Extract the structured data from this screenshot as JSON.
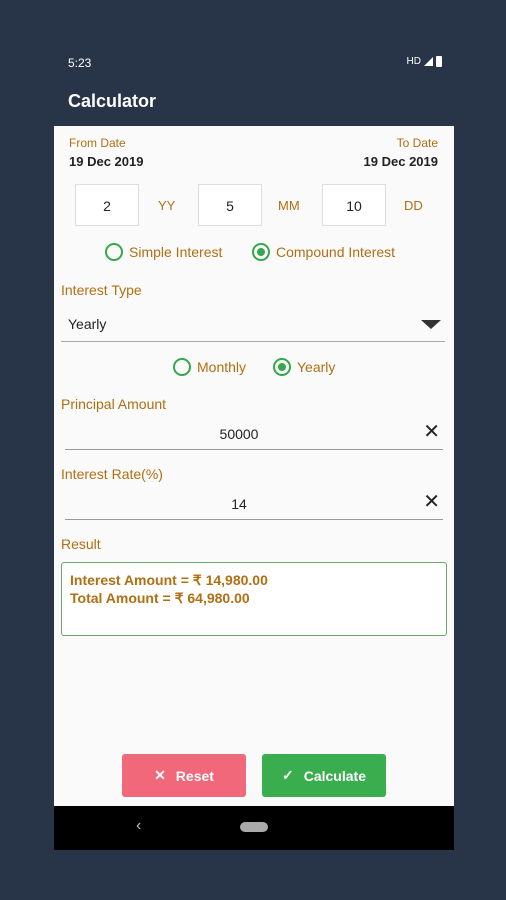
{
  "status": {
    "time": "5:23",
    "hd": "HD"
  },
  "app": {
    "title": "Calculator"
  },
  "dates": {
    "from_label": "From Date",
    "from_value": "19 Dec 2019",
    "to_label": "To Date",
    "to_value": "19 Dec 2019"
  },
  "duration": {
    "years": "2",
    "years_label": "YY",
    "months": "5",
    "months_label": "MM",
    "days": "10",
    "days_label": "DD"
  },
  "interest_mode": {
    "simple": "Simple Interest",
    "compound": "Compound Interest",
    "selected": "compound"
  },
  "interest_type": {
    "label": "Interest Type",
    "value": "Yearly"
  },
  "frequency": {
    "monthly": "Monthly",
    "yearly": "Yearly",
    "selected": "yearly"
  },
  "principal": {
    "label": "Principal Amount",
    "value": "50000"
  },
  "rate": {
    "label": "Interest Rate(%)",
    "value": "14"
  },
  "result": {
    "label": "Result",
    "interest_line": "Interest Amount = ₹ 14,980.00",
    "total_line": "Total Amount = ₹ 64,980.00"
  },
  "buttons": {
    "reset": "Reset",
    "calculate": "Calculate"
  },
  "colors": {
    "background": "#283549",
    "accent_orange": "#b06f12",
    "green": "#36a74a",
    "reset_red": "#f0687a",
    "calc_green": "#3aad4e"
  },
  "icons": {
    "clear": "close-icon",
    "reset": "close-icon",
    "calculate": "check-icon",
    "dropdown": "triangle-down-icon",
    "back": "chevron-left-icon"
  }
}
